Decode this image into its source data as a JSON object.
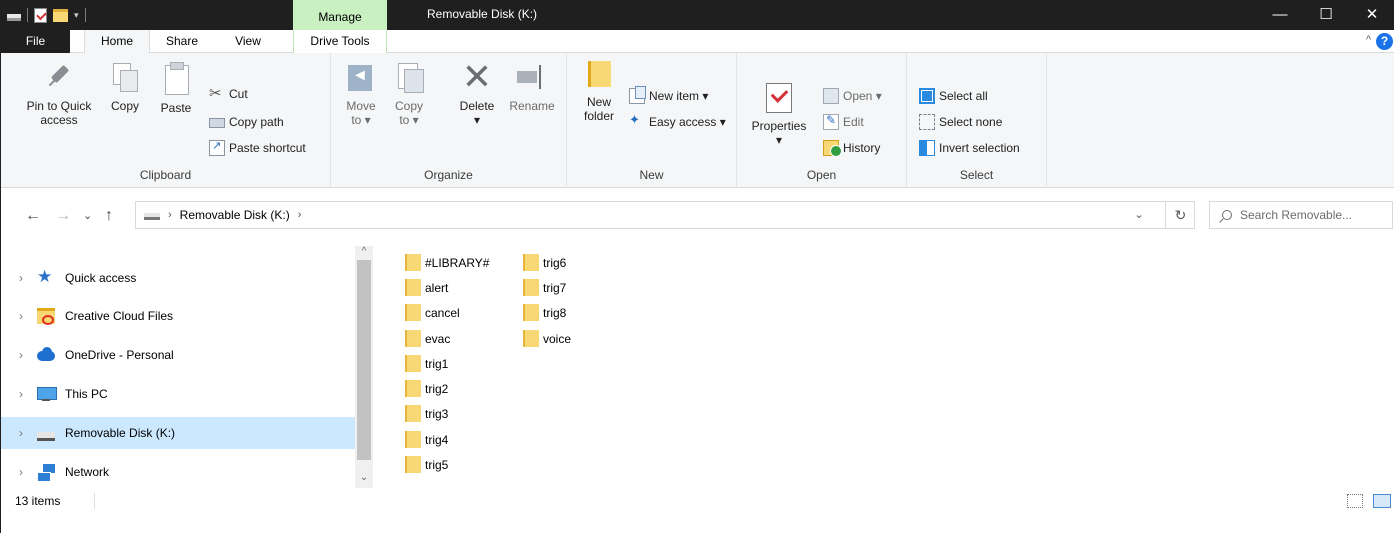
{
  "titlebar": {
    "title": "Removable Disk (K:)",
    "context_tab": "Manage",
    "minimize_glyph": "—",
    "maximize_glyph": "☐",
    "close_glyph": "✕"
  },
  "tabs": {
    "file": "File",
    "home": "Home",
    "share": "Share",
    "view": "View",
    "drive_tools": "Drive Tools",
    "collapse_glyph": "^",
    "help_glyph": "?"
  },
  "ribbon": {
    "clipboard": {
      "label": "Clipboard",
      "pin_line1": "Pin to Quick",
      "pin_line2": "access",
      "copy": "Copy",
      "paste": "Paste",
      "cut": "Cut",
      "copy_path": "Copy path",
      "paste_shortcut": "Paste shortcut"
    },
    "organize": {
      "label": "Organize",
      "move_line1": "Move",
      "move_line2": "to ▾",
      "copy_line1": "Copy",
      "copy_line2": "to ▾",
      "delete": "Delete",
      "delete_arrow": "▾",
      "rename": "Rename"
    },
    "new": {
      "label": "New",
      "folder_line1": "New",
      "folder_line2": "folder",
      "new_item": "New item ▾",
      "easy_access": "Easy access ▾"
    },
    "open": {
      "label": "Open",
      "properties": "Properties",
      "properties_arrow": "▾",
      "open": "Open ▾",
      "edit": "Edit",
      "history": "History"
    },
    "select": {
      "label": "Select",
      "select_all": "Select all",
      "select_none": "Select none",
      "invert_selection": "Invert selection"
    }
  },
  "address": {
    "back_glyph": "←",
    "forward_glyph": "→",
    "recent_glyph": "⌄",
    "up_glyph": "↑",
    "crumb_sep": "›",
    "location": "Removable Disk (K:)",
    "trailing_sep": "›",
    "dropdown_glyph": "⌄",
    "refresh_glyph": "↻",
    "search_placeholder": "Search Removable..."
  },
  "navigation": {
    "items": [
      {
        "label": "Quick access",
        "selected": false
      },
      {
        "label": "Creative Cloud Files",
        "selected": false
      },
      {
        "label": "OneDrive - Personal",
        "selected": false
      },
      {
        "label": "This PC",
        "selected": false
      },
      {
        "label": "Removable Disk (K:)",
        "selected": true
      },
      {
        "label": "Network",
        "selected": false
      }
    ],
    "expander_glyph": "›",
    "scroll_up_glyph": "^",
    "scroll_down_glyph": "⌄"
  },
  "files": {
    "column1": [
      "#LIBRARY#",
      "alert",
      "cancel",
      "evac",
      "trig1",
      "trig2",
      "trig3",
      "trig4",
      "trig5"
    ],
    "column2": [
      "trig6",
      "trig7",
      "trig8",
      "voice"
    ]
  },
  "status": {
    "item_count": "13 items"
  },
  "colors": {
    "titlebar": "#1f1f1f",
    "manage_tab": "#c9f0c0",
    "selection": "#cce8ff",
    "folder": "#f8d775",
    "ribbon_bg": "#f5f6f7"
  }
}
